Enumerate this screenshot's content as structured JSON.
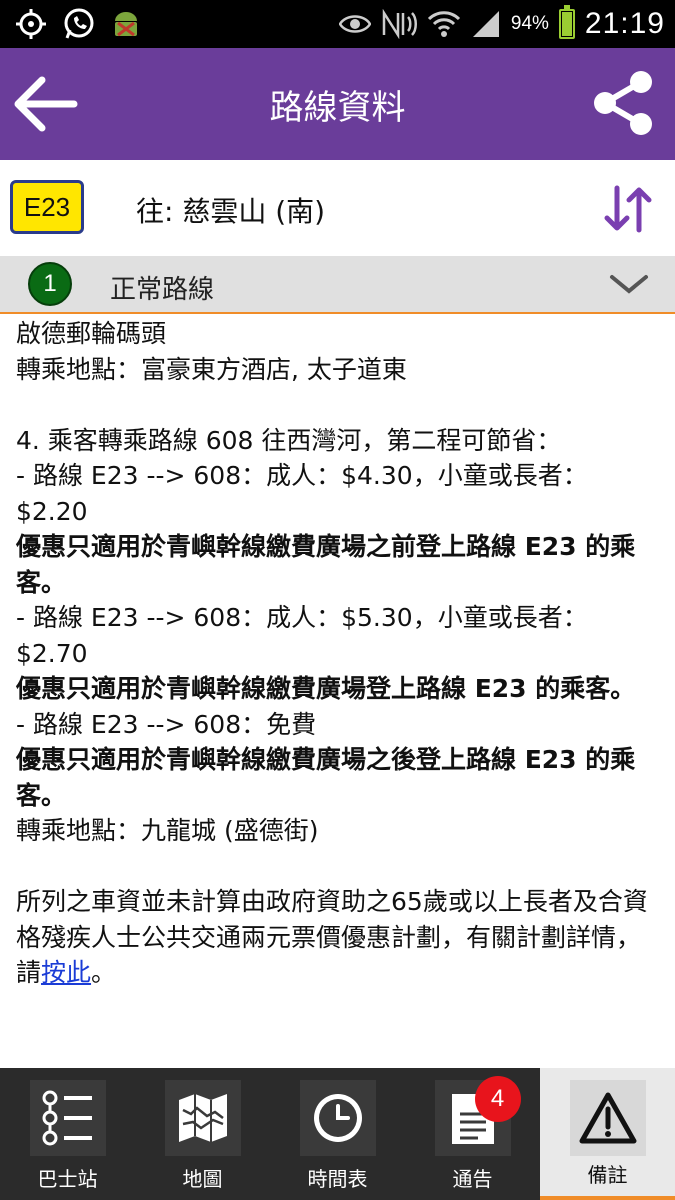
{
  "status_bar": {
    "battery_text": "94%",
    "battery_level": 0.94,
    "time": "21:19",
    "icons": [
      "gps-icon",
      "whatsapp-icon",
      "android-debug-icon",
      "eye-icon",
      "nfc-icon",
      "wifi-icon",
      "signal-icon",
      "battery-icon"
    ]
  },
  "app_bar": {
    "title": "路線資料",
    "back_icon": "arrow-left-icon",
    "share_icon": "share-icon",
    "background": "#6a3d9a"
  },
  "route": {
    "number": "E23",
    "destination": "往:  慈雲山 (南)",
    "badge_color": "#ffe600",
    "swap_icon": "swap-direction-icon",
    "accent": "#7a3fb0"
  },
  "variant": {
    "number": "1",
    "label": "正常路線",
    "circle_color": "#0a6b14"
  },
  "content": {
    "lines": [
      {
        "text": "啟德郵輪碼頭",
        "bold": false
      },
      {
        "text": "轉乘地點：富豪東方酒店, 太子道東",
        "bold": false
      },
      {
        "text": "",
        "bold": false
      },
      {
        "text": "4. 乘客轉乘路線 608 往西灣河，第二程可節省：",
        "bold": false
      },
      {
        "text": "- 路線 E23 --> 608：成人：$4.30，小童或長者：$2.20",
        "bold": false
      },
      {
        "text": "優惠只適用於青嶼幹線繳費廣場之前登上路線 E23 的乘客。",
        "bold": true
      },
      {
        "text": "- 路線 E23 --> 608：成人：$5.30，小童或長者：$2.70",
        "bold": false
      },
      {
        "text": "優惠只適用於青嶼幹線繳費廣場登上路線 E23 的乘客。",
        "bold": true
      },
      {
        "text": "- 路線 E23 --> 608：免費",
        "bold": false
      },
      {
        "text": "優惠只適用於青嶼幹線繳費廣場之後登上路線 E23 的乘客。",
        "bold": true
      },
      {
        "text": "轉乘地點：九龍城 (盛德街)",
        "bold": false
      },
      {
        "text": "",
        "bold": false
      }
    ],
    "footer_text": "所列之車資並未計算由政府資助之65歲或以上長者及合資格殘疾人士公共交通兩元票價優惠計劃，有關計劃詳情，請",
    "footer_link": "按此",
    "footer_end": "。",
    "link_color": "#1a3cd6"
  },
  "bottom_nav": {
    "items": [
      {
        "label": "巴士站",
        "icon": "bus-stop-list-icon",
        "active": false
      },
      {
        "label": "地圖",
        "icon": "map-icon",
        "active": false
      },
      {
        "label": "時間表",
        "icon": "clock-icon",
        "active": false
      },
      {
        "label": "通告",
        "icon": "notice-icon",
        "active": false,
        "badge": "4"
      },
      {
        "label": "備註",
        "icon": "warning-icon",
        "active": true
      }
    ],
    "active_underline": "#f08c28"
  }
}
